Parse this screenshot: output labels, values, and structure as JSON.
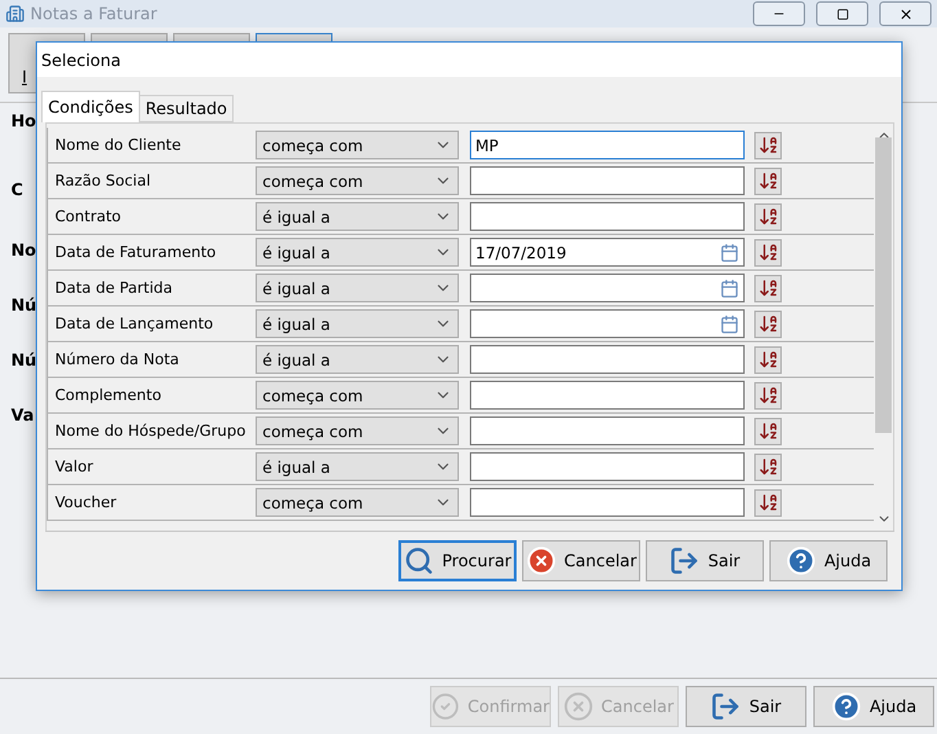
{
  "window": {
    "title": "Notas a Faturar"
  },
  "background_fragments": [
    "I",
    "Ho",
    "C",
    "No",
    "Nú",
    "Nú",
    "Va"
  ],
  "dialog": {
    "title": "Seleciona",
    "tabs": [
      {
        "label": "Condições",
        "selected": true
      },
      {
        "label": "Resultado",
        "selected": false
      }
    ],
    "conditions": [
      {
        "field": "Nome do Cliente",
        "operator": "começa com",
        "value": "MP",
        "kind": "text",
        "focused": true
      },
      {
        "field": "Razão Social",
        "operator": "começa com",
        "kind": "text",
        "focused": false
      },
      {
        "field": "Contrato",
        "operator": "é igual a",
        "kind": "text",
        "focused": false
      },
      {
        "field": "Data de Faturamento",
        "operator": "é igual a",
        "value": "17/07/2019",
        "kind": "date",
        "focused": false
      },
      {
        "field": "Data de Partida",
        "operator": "é igual a",
        "kind": "date",
        "focused": false
      },
      {
        "field": "Data de Lançamento",
        "operator": "é igual a",
        "kind": "date",
        "focused": false
      },
      {
        "field": "Número da Nota",
        "operator": "é igual a",
        "kind": "text",
        "focused": false
      },
      {
        "field": "Complemento",
        "operator": "começa com",
        "kind": "text",
        "focused": false
      },
      {
        "field": "Nome do Hóspede/Grupo",
        "operator": "começa com",
        "kind": "text",
        "focused": false
      },
      {
        "field": "Valor",
        "operator": "é igual a",
        "kind": "text",
        "focused": false
      },
      {
        "field": "Voucher",
        "operator": "começa com",
        "kind": "text",
        "focused": false
      }
    ],
    "buttons": [
      {
        "label": "Procurar",
        "kind": "search",
        "focused": true
      },
      {
        "label": "Cancelar",
        "kind": "cancel",
        "focused": false
      },
      {
        "label": "Sair",
        "kind": "exit",
        "focused": false
      },
      {
        "label": "Ajuda",
        "kind": "help",
        "focused": false
      }
    ]
  },
  "buttons": [
    {
      "label": "Confirmar",
      "kind": "confirm",
      "disabled": true
    },
    {
      "label": "Cancelar",
      "kind": "cancel",
      "disabled": true
    },
    {
      "label": "Sair",
      "kind": "exit",
      "disabled": false
    },
    {
      "label": "Ajuda",
      "kind": "help",
      "disabled": false
    }
  ]
}
